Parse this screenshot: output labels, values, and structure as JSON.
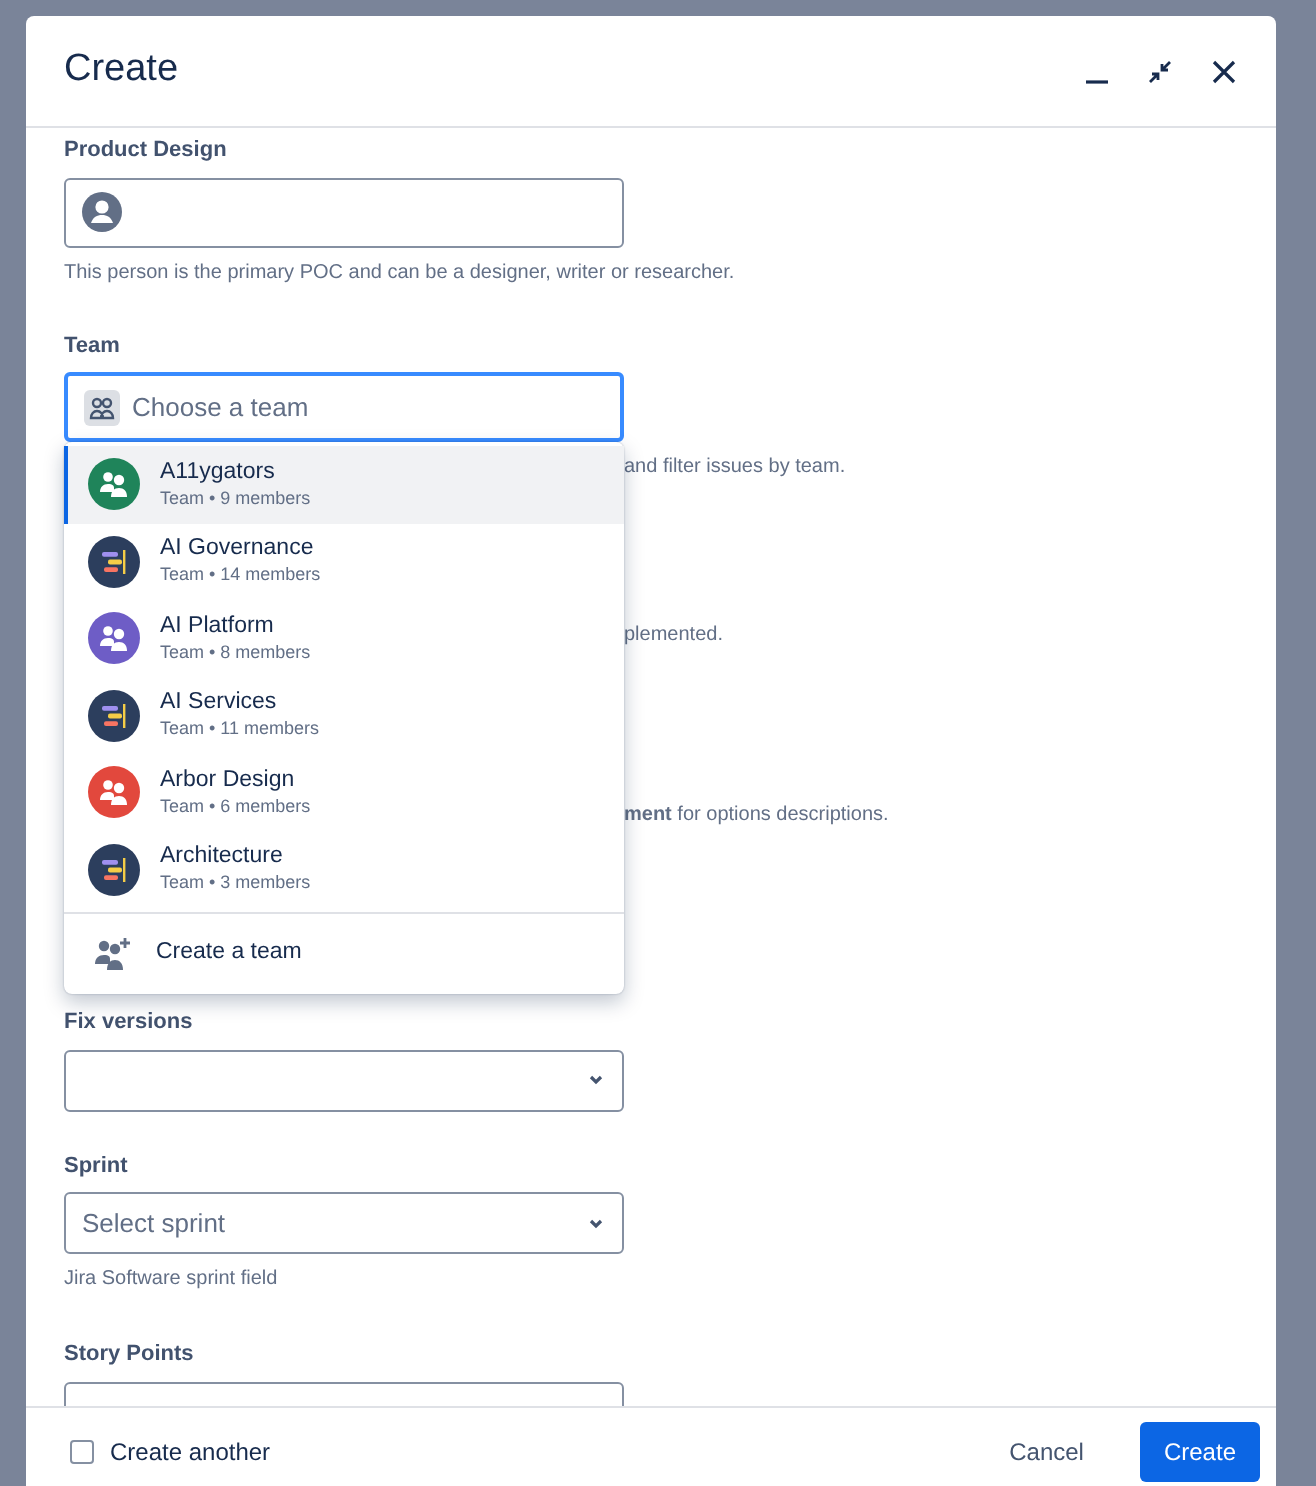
{
  "dialog": {
    "title": "Create"
  },
  "fields": {
    "product_design": {
      "label": "Product Design",
      "help": "This person is the primary POC and can be a designer, writer or researcher."
    },
    "team": {
      "label": "Team",
      "placeholder": "Choose a team"
    },
    "covered_texts": [
      {
        "text": "and filter issues by team."
      },
      {
        "text": "plemented."
      },
      {
        "text": "**ment** for options descriptions."
      }
    ],
    "fix_versions": {
      "label": "Fix versions"
    },
    "sprint": {
      "label": "Sprint",
      "placeholder": "Select sprint",
      "help": "Jira Software sprint field"
    },
    "story_points": {
      "label": "Story Points"
    }
  },
  "team_dropdown": {
    "options": [
      {
        "name": "A11ygators",
        "meta": "Team • 9 members",
        "kind": "people",
        "color": "#1f845a",
        "selected": true
      },
      {
        "name": "AI Governance",
        "meta": "Team • 14 members",
        "kind": "bars",
        "color": "#2c3e5d",
        "selected": false
      },
      {
        "name": "AI Platform",
        "meta": "Team • 8 members",
        "kind": "people",
        "color": "#6e5dc6",
        "selected": false
      },
      {
        "name": "AI Services",
        "meta": "Team • 11 members",
        "kind": "bars",
        "color": "#2c3e5d",
        "selected": false
      },
      {
        "name": "Arbor Design",
        "meta": "Team • 6 members",
        "kind": "people",
        "color": "#e2483d",
        "selected": false
      },
      {
        "name": "Architecture",
        "meta": "Team • 3 members",
        "kind": "bars",
        "color": "#2c3e5d",
        "selected": false
      }
    ],
    "create_label": "Create a team"
  },
  "footer": {
    "create_another": {
      "label": "Create another",
      "checked": false
    },
    "buttons": [
      {
        "label": "Cancel",
        "kind": "subtle"
      },
      {
        "label": "Create",
        "kind": "primary"
      }
    ]
  }
}
